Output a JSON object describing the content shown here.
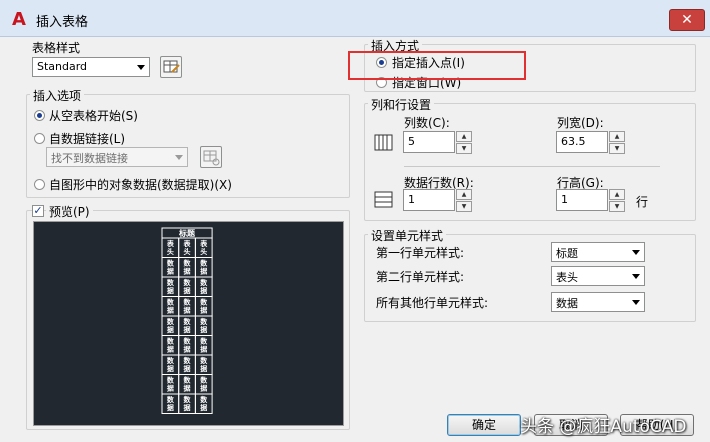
{
  "window": {
    "title": "插入表格",
    "logo": "A",
    "close": "✕"
  },
  "table_style": {
    "label": "表格样式",
    "value": "Standard"
  },
  "insert_options": {
    "label": "插入选项",
    "option_empty": "从空表格开始(S)",
    "option_link": "自数据链接(L)",
    "link_combo": "找不到数据链接",
    "option_extract": "自图形中的对象数据(数据提取)(X)"
  },
  "preview": {
    "label": "预览(P)",
    "checked": true,
    "table_title": "标题",
    "header_cell": "表头",
    "data_cell": "数据"
  },
  "insert_method": {
    "label": "插入方式",
    "option_point": "指定插入点(I)",
    "option_window": "指定窗口(W)"
  },
  "rows_cols": {
    "label": "列和行设置",
    "columns_label": "列数(C):",
    "columns_value": "5",
    "col_width_label": "列宽(D):",
    "col_width_value": "63.5",
    "data_rows_label": "数据行数(R):",
    "data_rows_value": "1",
    "row_height_label": "行高(G):",
    "row_height_value": "1",
    "row_unit": "行"
  },
  "cell_styles": {
    "label": "设置单元样式",
    "first_row_label": "第一行单元样式:",
    "first_row_value": "标题",
    "second_row_label": "第二行单元样式:",
    "second_row_value": "表头",
    "other_rows_label": "所有其他行单元样式:",
    "other_rows_value": "数据"
  },
  "buttons": {
    "ok": "确定",
    "cancel": "取消",
    "help": "帮助(H)"
  },
  "watermark": "头条 @疯狂AutoCAD"
}
